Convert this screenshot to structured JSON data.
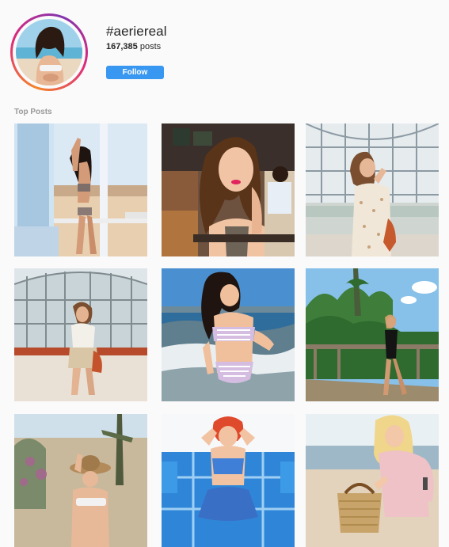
{
  "hashtag": {
    "title": "#aeriereal",
    "count": "167,385",
    "count_label": "posts"
  },
  "follow_label": "Follow",
  "section_label": "Top Posts",
  "posts": [
    {
      "icon": "photo-beach-lifeguard-tower"
    },
    {
      "icon": "photo-cafe-woman"
    },
    {
      "icon": "photo-greenhouse-dress"
    },
    {
      "icon": "photo-greenhouse-outfit"
    },
    {
      "icon": "photo-ocean-swimsuit"
    },
    {
      "icon": "photo-deck-swimsuit"
    },
    {
      "icon": "photo-desert-hat"
    },
    {
      "icon": "photo-yoga-pool"
    },
    {
      "icon": "photo-beach-basket"
    }
  ],
  "colors": {
    "accent": "#3897f0",
    "muted": "#999999",
    "text": "#262626"
  }
}
